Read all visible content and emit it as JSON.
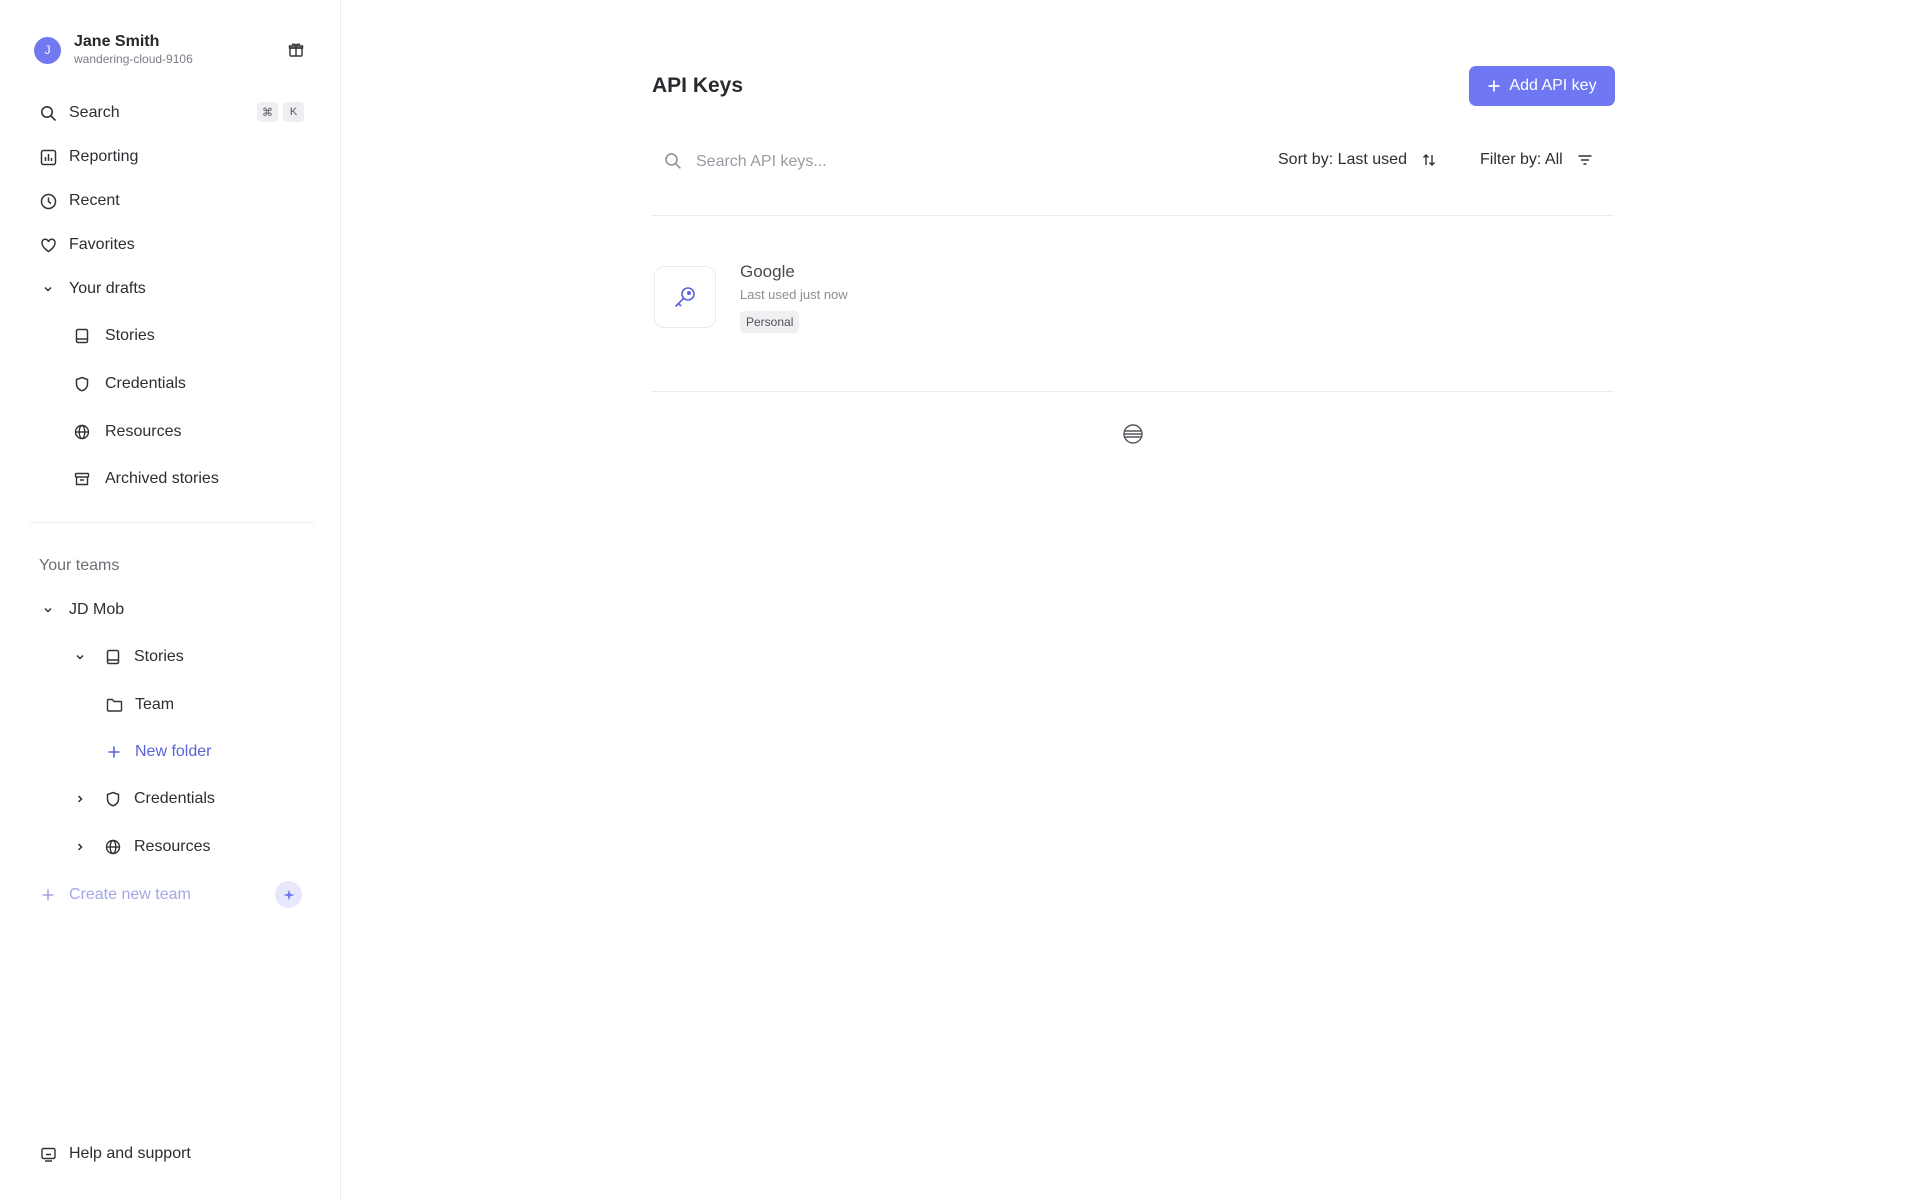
{
  "user": {
    "initial": "J",
    "name": "Jane Smith",
    "handle": "wandering-cloud-9106"
  },
  "nav": {
    "search": "Search",
    "shortcut": [
      "⌘",
      "K"
    ],
    "reporting": "Reporting",
    "recent": "Recent",
    "favorites": "Favorites",
    "drafts": "Your drafts",
    "drafts_items": [
      "Stories",
      "Credentials",
      "Resources",
      "Archived stories"
    ]
  },
  "teams": {
    "label": "Your teams",
    "team_name": "JD Mob",
    "stories": "Stories",
    "team_folder": "Team",
    "new_folder": "New folder",
    "credentials": "Credentials",
    "resources": "Resources",
    "create_team": "Create new team"
  },
  "help": "Help and support",
  "main": {
    "title": "API Keys",
    "add_button": "Add API key",
    "search_placeholder": "Search API keys...",
    "sort_label": "Sort by: Last used",
    "filter_label": "Filter by: All"
  },
  "api_keys": [
    {
      "name": "Google",
      "last_used": "Last used just now",
      "badge": "Personal"
    }
  ],
  "colors": {
    "accent": "#6f77f2",
    "avatar": "#7279f0",
    "link": "#5b62d8"
  }
}
